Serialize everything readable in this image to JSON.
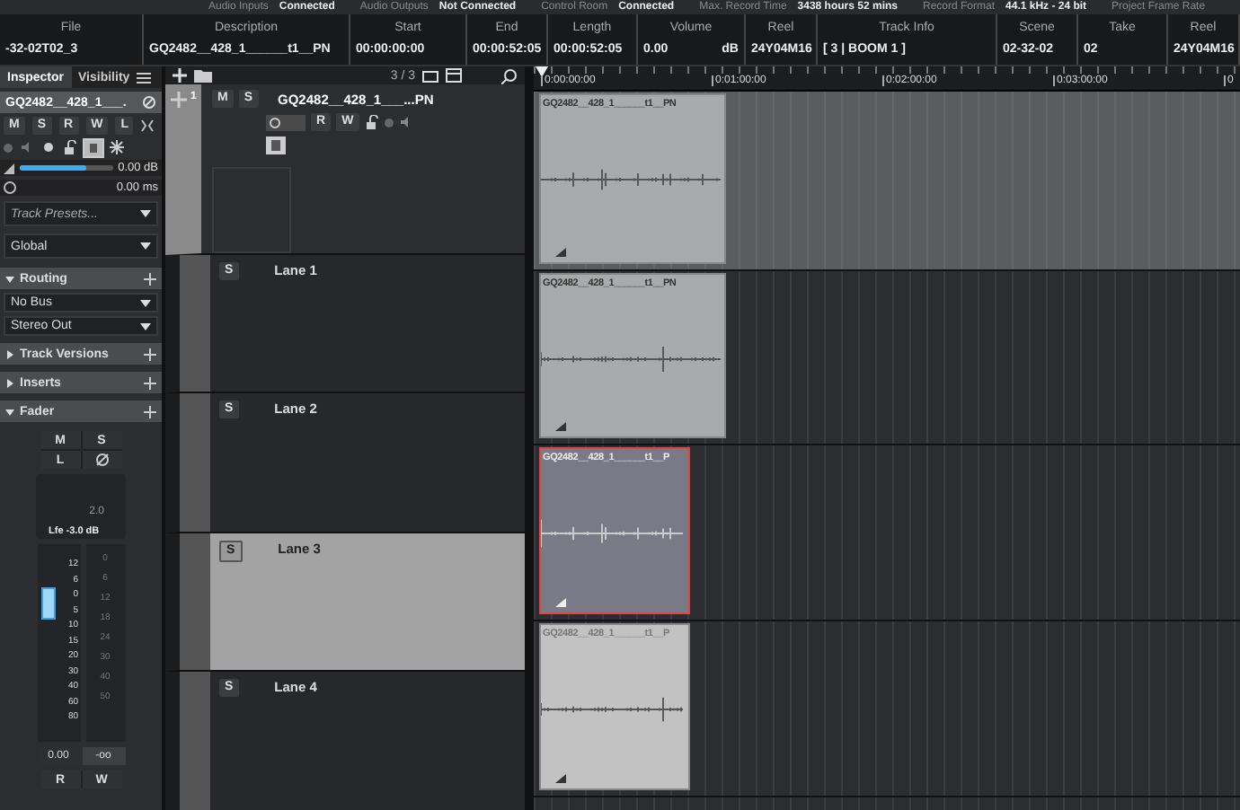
{
  "status_strip": [
    {
      "label": "Audio Inputs",
      "value": "Connected"
    },
    {
      "label": "Audio Outputs",
      "value": "Not Connected"
    },
    {
      "label": "Control Room",
      "value": "Connected"
    },
    {
      "label": "Max. Record Time",
      "value": "3438 hours 52 mins"
    },
    {
      "label": "Record Format",
      "value": "44.1 kHz - 24 bit"
    },
    {
      "label": "Project Frame Rate"
    }
  ],
  "info_line": [
    {
      "header": "File",
      "value": "-32-02T02_3"
    },
    {
      "header": "Description",
      "value": "GQ2482__428_1______t1__PN"
    },
    {
      "header": "Start",
      "value": "00:00:00:00"
    },
    {
      "header": "End",
      "value": "00:00:52:05"
    },
    {
      "header": "Length",
      "value": "00:00:52:05"
    },
    {
      "header": "Volume",
      "value": "0.00",
      "unit": "dB"
    },
    {
      "header": "Reel",
      "value": "24Y04M16"
    },
    {
      "header": "Track Info",
      "value": "[ 3 | BOOM 1 ]"
    },
    {
      "header": "Scene",
      "value": "02-32-02"
    },
    {
      "header": "Take",
      "value": "02"
    },
    {
      "header": "Reel",
      "value": "24Y04M16"
    }
  ],
  "inspector": {
    "tabs": [
      {
        "label": "Inspector",
        "selected": true
      },
      {
        "label": "Visibility",
        "selected": false
      }
    ],
    "track_name": "GQ2482__428_1___.",
    "buttons_top": [
      "M",
      "S",
      "R",
      "W",
      "L"
    ],
    "volume": {
      "level": 0.72,
      "reading": "0.00 dB"
    },
    "delay": "0.00 ms",
    "presets_placeholder": "Track Presets...",
    "global": "Global",
    "sections": [
      {
        "title": "Routing",
        "expanded": true,
        "items": [
          "No Bus",
          "Stereo Out"
        ]
      },
      {
        "title": "Track Versions",
        "expanded": false
      },
      {
        "title": "Inserts",
        "expanded": false
      },
      {
        "title": "Fader",
        "expanded": true
      }
    ],
    "fader": {
      "buttons": [
        "M",
        "S",
        "L"
      ],
      "panner_label": "2.0",
      "panner_reading": "Lfe -3.0 dB",
      "scale": [
        "12",
        "6",
        "0",
        "5",
        "10",
        "15",
        "20",
        "30",
        "40",
        "60",
        "80"
      ],
      "meter_scale": [
        "0",
        "6",
        "12",
        "18",
        "24",
        "30",
        "40",
        "50"
      ],
      "level": 0.72,
      "value": "0.00",
      "peak": "-oo",
      "buttons_bottom": [
        "R",
        "W"
      ]
    }
  },
  "track_list": {
    "count": "3 / 3",
    "track": {
      "number": "1",
      "name": "GQ2482__428_1___...PN",
      "selected": true,
      "buttons": [
        "M",
        "S",
        "R",
        "W"
      ]
    },
    "lanes": [
      {
        "name": "Lane 1",
        "button": "S",
        "selected": false
      },
      {
        "name": "Lane 2",
        "button": "S",
        "selected": false
      },
      {
        "name": "Lane 3",
        "button": "S",
        "selected": true
      },
      {
        "name": "Lane 4",
        "button": "S",
        "selected": false
      }
    ]
  },
  "ruler": [
    "0:00:00:00",
    "0:01:00:00",
    "0:02:00:00",
    "0:03:00:00",
    "0"
  ],
  "clips": [
    {
      "name": "GQ2482__428_1______t1__PN",
      "selected": false,
      "muted": false
    },
    {
      "name": "GQ2482__428_1______t1__PN",
      "selected": false,
      "muted": false
    },
    {
      "name": "GQ2482__428_1______t1__P",
      "selected": true,
      "muted": false
    },
    {
      "name": "GQ2482__428_1______t1__P",
      "selected": false,
      "muted": true
    }
  ]
}
